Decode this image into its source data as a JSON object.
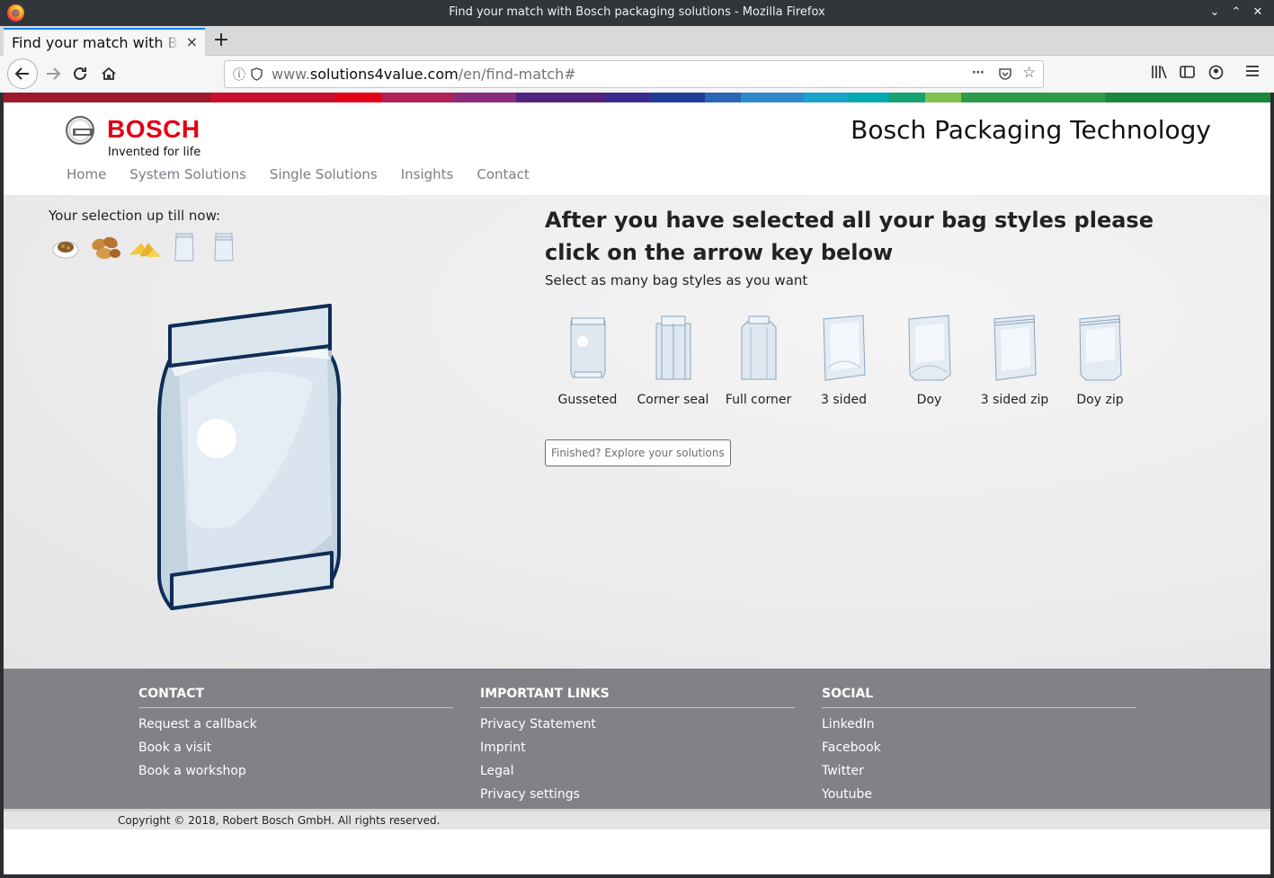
{
  "window": {
    "title": "Find your match with Bosch packaging solutions - Mozilla Firefox"
  },
  "browser": {
    "tab_title": "Find your match with Bosch packaging solutions",
    "url_prefix": "www.",
    "url_domain": "solutions4value.com",
    "url_path": "/en/find-match#",
    "new_tab": "+",
    "tab_close": "×"
  },
  "colors": {
    "brand_red": "#e20015",
    "stripe": [
      "#9c1a2b",
      "#c8102e",
      "#e20015",
      "#b22256",
      "#8a2a7c",
      "#50237f",
      "#3a2c8f",
      "#1e3d99",
      "#2a66b5",
      "#2e8acb",
      "#1aa3c9",
      "#00a8b0",
      "#16a26e",
      "#7fc24b",
      "#2e9b4b",
      "#1a8a3a"
    ]
  },
  "header": {
    "brand": "BOSCH",
    "tagline": "Invented for life",
    "site_title": "Bosch Packaging Technology",
    "nav": [
      "Home",
      "System Solutions",
      "Single Solutions",
      "Insights",
      "Contact"
    ]
  },
  "content": {
    "selection_label": "Your selection up till now:",
    "selection_icons": [
      "coffee-icon",
      "nuts-icon",
      "chips-icon",
      "bag-icon",
      "bag-icon"
    ],
    "headline": "After you have selected all your bag styles please click on the arrow key below",
    "subline": "Select as many bag styles as you want",
    "bag_styles": [
      {
        "label": "Gusseted",
        "icon": "gusseted-bag-icon"
      },
      {
        "label": "Corner seal",
        "icon": "corner-seal-bag-icon"
      },
      {
        "label": "Full corner",
        "icon": "full-corner-bag-icon"
      },
      {
        "label": "3 sided",
        "icon": "three-sided-bag-icon"
      },
      {
        "label": "Doy",
        "icon": "doy-bag-icon"
      },
      {
        "label": "3 sided zip",
        "icon": "three-sided-zip-bag-icon"
      },
      {
        "label": "Doy zip",
        "icon": "doy-zip-bag-icon"
      }
    ],
    "explore_button": "Finished? Explore your solutions"
  },
  "footer": {
    "columns": [
      {
        "title": "CONTACT",
        "links": [
          "Request a callback",
          "Book a visit",
          "Book a workshop"
        ]
      },
      {
        "title": "IMPORTANT LINKS",
        "links": [
          "Privacy Statement",
          "Imprint",
          "Legal",
          "Privacy settings"
        ]
      },
      {
        "title": "SOCIAL",
        "links": [
          "LinkedIn",
          "Facebook",
          "Twitter",
          "Youtube"
        ]
      }
    ],
    "copyright": "Copyright © 2018, Robert Bosch GmbH. All rights reserved."
  }
}
